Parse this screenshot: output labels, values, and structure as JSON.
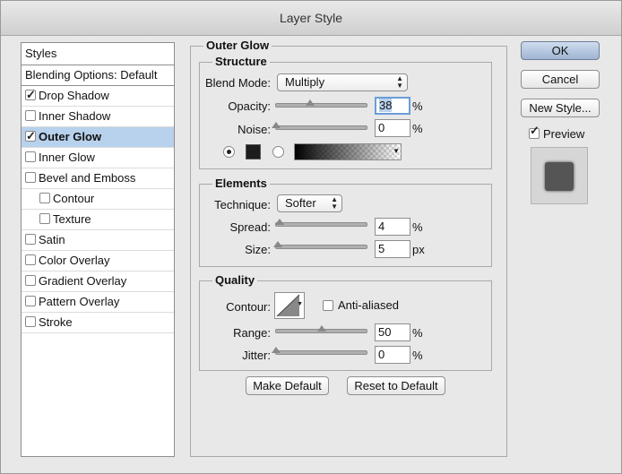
{
  "window": {
    "title": "Layer Style"
  },
  "styles_panel": {
    "header": "Styles",
    "blending": "Blending Options: Default",
    "items": [
      {
        "label": "Drop Shadow",
        "checked": true,
        "indent": false,
        "selected": false
      },
      {
        "label": "Inner Shadow",
        "checked": false,
        "indent": false,
        "selected": false
      },
      {
        "label": "Outer Glow",
        "checked": true,
        "indent": false,
        "selected": true
      },
      {
        "label": "Inner Glow",
        "checked": false,
        "indent": false,
        "selected": false
      },
      {
        "label": "Bevel and Emboss",
        "checked": false,
        "indent": false,
        "selected": false
      },
      {
        "label": "Contour",
        "checked": false,
        "indent": true,
        "selected": false
      },
      {
        "label": "Texture",
        "checked": false,
        "indent": true,
        "selected": false
      },
      {
        "label": "Satin",
        "checked": false,
        "indent": false,
        "selected": false
      },
      {
        "label": "Color Overlay",
        "checked": false,
        "indent": false,
        "selected": false
      },
      {
        "label": "Gradient Overlay",
        "checked": false,
        "indent": false,
        "selected": false
      },
      {
        "label": "Pattern Overlay",
        "checked": false,
        "indent": false,
        "selected": false
      },
      {
        "label": "Stroke",
        "checked": false,
        "indent": false,
        "selected": false
      }
    ]
  },
  "outer_glow": {
    "title": "Outer Glow",
    "structure": {
      "title": "Structure",
      "blend_mode_label": "Blend Mode:",
      "blend_mode_value": "Multiply",
      "opacity_label": "Opacity:",
      "opacity_value": "38",
      "opacity_fraction": 0.38,
      "noise_label": "Noise:",
      "noise_value": "0",
      "noise_fraction": 0.0,
      "percent": "%",
      "color": "#1d1d1d"
    },
    "elements": {
      "title": "Elements",
      "technique_label": "Technique:",
      "technique_value": "Softer",
      "spread_label": "Spread:",
      "spread_value": "4",
      "spread_fraction": 0.04,
      "size_label": "Size:",
      "size_value": "5",
      "size_fraction": 0.02,
      "percent": "%",
      "px": "px"
    },
    "quality": {
      "title": "Quality",
      "contour_label": "Contour:",
      "anti_aliased_label": "Anti-aliased",
      "anti_aliased": false,
      "range_label": "Range:",
      "range_value": "50",
      "range_fraction": 0.5,
      "jitter_label": "Jitter:",
      "jitter_value": "0",
      "jitter_fraction": 0.0,
      "percent": "%"
    },
    "make_default": "Make Default",
    "reset_default": "Reset to Default"
  },
  "actions": {
    "ok": "OK",
    "cancel": "Cancel",
    "new_style": "New Style...",
    "preview_label": "Preview",
    "preview_checked": true
  }
}
